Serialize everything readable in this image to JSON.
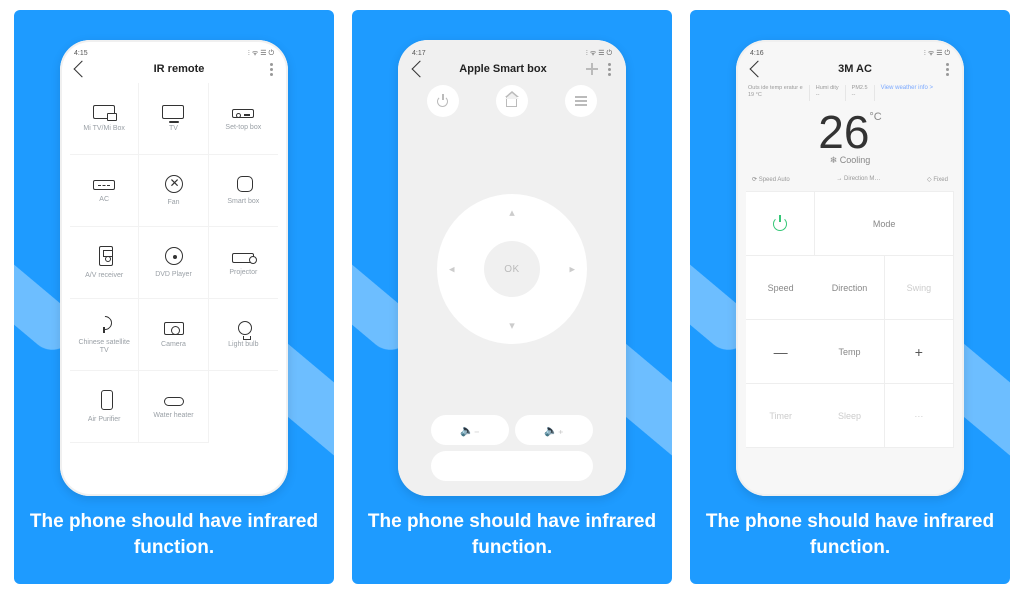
{
  "caption": "The phone should have infrared function.",
  "status": {
    "time1": "4:15",
    "time2": "4:17",
    "time3": "4:16",
    "icons": "ⵗ ᯤ ☰ ⏻"
  },
  "screen1": {
    "title": "IR remote",
    "items": [
      {
        "label": "Mi TV/Mi Box"
      },
      {
        "label": "TV"
      },
      {
        "label": "Set-top box"
      },
      {
        "label": "AC"
      },
      {
        "label": "Fan"
      },
      {
        "label": "Smart box"
      },
      {
        "label": "A/V receiver"
      },
      {
        "label": "DVD Player"
      },
      {
        "label": "Projector"
      },
      {
        "label": "Chinese satellite TV"
      },
      {
        "label": "Camera"
      },
      {
        "label": "Light bulb"
      },
      {
        "label": "Air Purifier"
      },
      {
        "label": "Water heater"
      }
    ]
  },
  "screen2": {
    "title": "Apple Smart box",
    "ok": "OK",
    "vol_down": "🔉",
    "vol_up": "🔊"
  },
  "screen3": {
    "title": "3M AC",
    "stats": {
      "out_label": "Outs ide temp eratur e",
      "out_val": "19 °C",
      "hum_label": "Humi dity",
      "hum_val": "--",
      "pm_label": "PM2.5",
      "pm_val": "--"
    },
    "weather": "View weather info >",
    "temp": "26",
    "deg": "°C",
    "mode": "❄ Cooling",
    "quick": {
      "speed": "Speed Auto",
      "dir": "Direction M…",
      "fixed": "Fixed"
    },
    "buttons": {
      "power": "",
      "mode": "Mode",
      "speed": "Speed",
      "direction": "Direction",
      "swing": "Swing",
      "minus": "—",
      "temp": "Temp",
      "plus": "+",
      "timer": "Timer",
      "sleep": "Sleep",
      "more": "···"
    }
  }
}
